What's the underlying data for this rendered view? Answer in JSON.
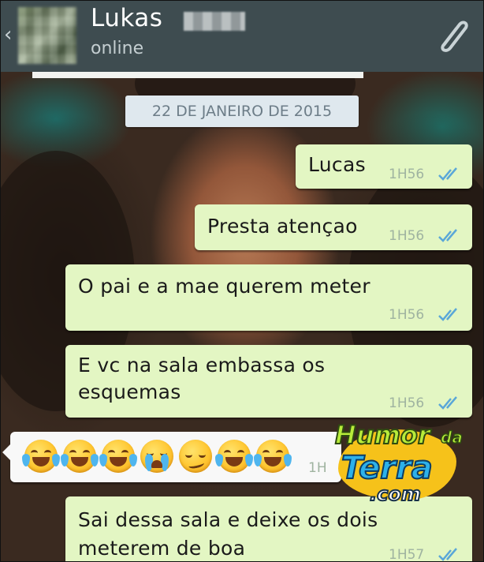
{
  "header": {
    "contact_name": "Lukas",
    "status": "online",
    "back_icon": "chevron-left-icon",
    "attach_icon": "paperclip-icon"
  },
  "chat": {
    "date_divider": "22 DE JANEIRO DE 2015",
    "messages": [
      {
        "direction": "out",
        "text": "Lucas",
        "time": "1H56",
        "status": "read"
      },
      {
        "direction": "out",
        "text": "Presta atençao",
        "time": "1H56",
        "status": "read"
      },
      {
        "direction": "out",
        "text": "O pai e a mae querem meter",
        "time": "1H56",
        "status": "read"
      },
      {
        "direction": "out",
        "lines": [
          "E vc na sala embassa os",
          "esquemas"
        ],
        "time": "1H56",
        "status": "read"
      },
      {
        "direction": "in",
        "emojis": [
          "face-with-tears-of-joy",
          "face-with-tears-of-joy",
          "face-with-tears-of-joy",
          "loudly-crying-face",
          "smirking-face",
          "face-with-tears-of-joy",
          "face-with-tears-of-joy"
        ],
        "time": "1H"
      },
      {
        "direction": "out",
        "lines": [
          "Sai dessa sala e deixe os dois",
          "meterem de boa"
        ],
        "time": "1H57",
        "status": "read"
      }
    ]
  },
  "watermark": {
    "line1": "Humor",
    "line2": "da",
    "line3": "Terra",
    "line4": ".com"
  },
  "colors": {
    "header_bg": "#3e4c50",
    "outgoing_bubble": "#e3f6c3",
    "incoming_bubble": "#f8f8f8",
    "read_ticks": "#5aa7d8"
  }
}
